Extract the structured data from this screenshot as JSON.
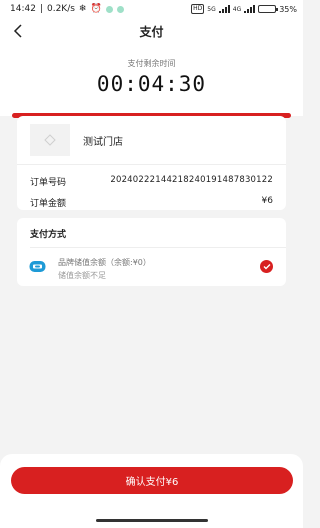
{
  "status_bar": {
    "time": "14:42",
    "network_speed": "0.2K/s",
    "hd_label": "HD",
    "signal1_label": "5G",
    "signal2_label": "4G",
    "battery_percent": "35%",
    "battery_level": 0.35,
    "icons": [
      "snowflake-icon",
      "alarm-icon",
      "app-dot-icon",
      "app-dot-icon"
    ]
  },
  "nav": {
    "title": "支付",
    "back_icon": "chevron-left-icon"
  },
  "countdown": {
    "label": "支付剩余时间",
    "time": "00:04:30"
  },
  "store": {
    "name": "测试门店",
    "thumb_icon": "image-placeholder-icon"
  },
  "order": {
    "number_label": "订单号码",
    "number_value": "20240222144218240191487830122",
    "amount_label": "订单金额",
    "amount_value": "¥6"
  },
  "payment": {
    "title": "支付方式",
    "option_name": "品牌储值余额（余额:¥0）",
    "option_note": "储值余额不足",
    "option_icon": "wallet-icon",
    "selected_icon": "check-icon"
  },
  "confirm": {
    "label": "确认支付¥6"
  },
  "colors": {
    "accent": "#d82020",
    "wallet": "#1e9ad6"
  }
}
